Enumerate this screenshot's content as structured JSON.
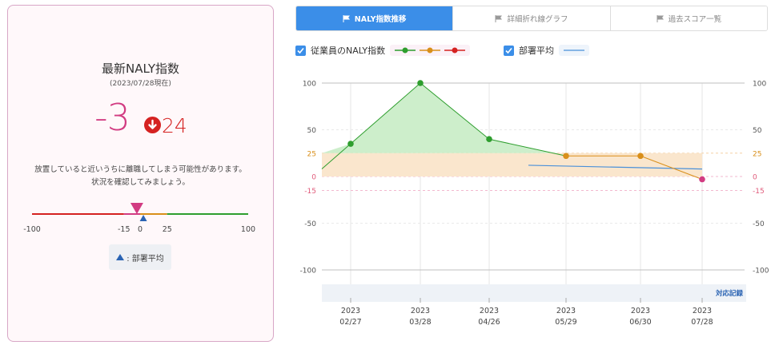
{
  "left_card": {
    "title": "最新NALY指数",
    "as_of": "(2023/07/28現在)",
    "score": "-3",
    "delta": "24",
    "message_line1": "放置していると近いうちに離職してしまう可能性があります。",
    "message_line2": "状況を確認してみましょう。",
    "scale_ticks": [
      "-100",
      "-15",
      "0",
      "25",
      "100"
    ],
    "scale_values": [
      -100,
      -15,
      0,
      25,
      100
    ],
    "employee_marker": -3,
    "dept_marker": 3,
    "legend_label": ": 部署平均",
    "colors": {
      "score": "#d23c82",
      "delta": "#d52221",
      "marker": "#d23c82",
      "dept": "#2a63b3"
    }
  },
  "tabs": [
    {
      "label": "NALY指数推移",
      "active": true,
      "icon": "flag-icon"
    },
    {
      "label": "詳細折れ線グラフ",
      "active": false,
      "icon": "flag-icon"
    },
    {
      "label": "過去スコア一覧",
      "active": false,
      "icon": "flag-icon"
    }
  ],
  "legend": {
    "employee_label": "従業員のNALY指数",
    "dept_label": "部署平均"
  },
  "chart_data": {
    "type": "line",
    "x": [
      "2023/02/27",
      "2023/03/28",
      "2023/04/26",
      "2023/05/29",
      "2023/06/30",
      "2023/07/28"
    ],
    "x_tick_labels": [
      {
        "year": "2023",
        "md": "02/27"
      },
      {
        "year": "2023",
        "md": "03/28"
      },
      {
        "year": "2023",
        "md": "04/26"
      },
      {
        "year": "2023",
        "md": "05/29"
      },
      {
        "year": "2023",
        "md": "06/30"
      },
      {
        "year": "2023",
        "md": "07/28"
      }
    ],
    "series": [
      {
        "name": "従業員のNALY指数",
        "values": [
          35,
          100,
          40,
          22,
          22,
          -3
        ]
      },
      {
        "name": "部署平均",
        "values": [
          null,
          null,
          null,
          12,
          11,
          8
        ]
      }
    ],
    "y_ticks": [
      100,
      50,
      25,
      0,
      -15,
      -50,
      -100
    ],
    "ylim": [
      -100,
      100
    ],
    "bands": {
      "upper": 25,
      "lower": -15
    },
    "annotation": "対応記録",
    "colors": {
      "green": "#2e9e2e",
      "orange": "#d98f1a",
      "red": "#d52221",
      "pink": "#d23c82",
      "dept": "#4a90d9",
      "green_fill": "#cdeecb",
      "orange_fill": "#fae6cd"
    }
  }
}
